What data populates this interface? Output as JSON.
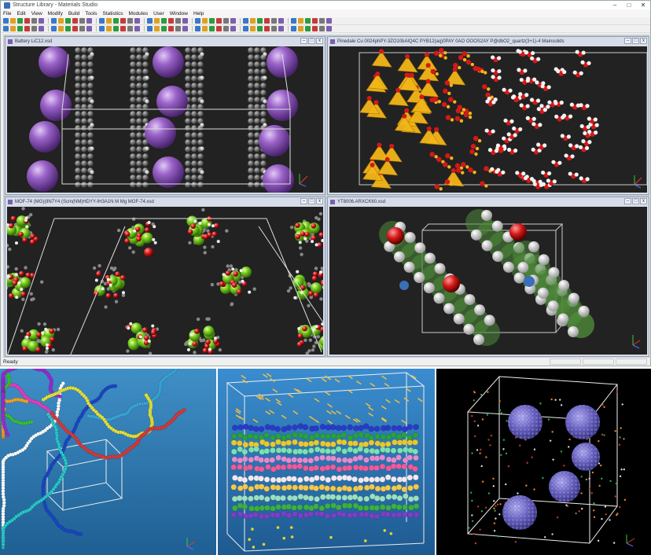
{
  "window": {
    "title": "Structure Library - Materials Studio",
    "controls": [
      "–",
      "□",
      "✕"
    ]
  },
  "menu": [
    "File",
    "Edit",
    "View",
    "Modify",
    "Build",
    "Tools",
    "Statistics",
    "Modules",
    "User",
    "Window",
    "Help"
  ],
  "documents": [
    {
      "title": "Battery LiC12.xsd"
    },
    {
      "title": "Pinedale Cu 0024phPY-3ZO10bAlQ4C PYB12(aq)0PAY 0AO OOOS2AY P@dbO2_quartz(3+1)-4 Mainsolids"
    },
    {
      "title": "MOF-74 (MG)(lIN7Y4 (Scm(NM)HDYY-IH3A1N M Mg MOF-74.xsd"
    },
    {
      "title": "YT8006.ARXCK60.xsd"
    }
  ],
  "status": {
    "text": "Ready"
  },
  "axes_labels": {
    "x": "X",
    "y": "Y",
    "z": "Z"
  },
  "colors": {
    "lithium": "#9a63c9",
    "carbon": "#5a5a5a",
    "hydrogen": "#e8e8e8",
    "oxygen": "#d41818",
    "silicate": "#f2b619",
    "magnesium": "#7fd322",
    "nitrogen": "#3b6fb8",
    "helix_green": "#4f8a3a"
  }
}
